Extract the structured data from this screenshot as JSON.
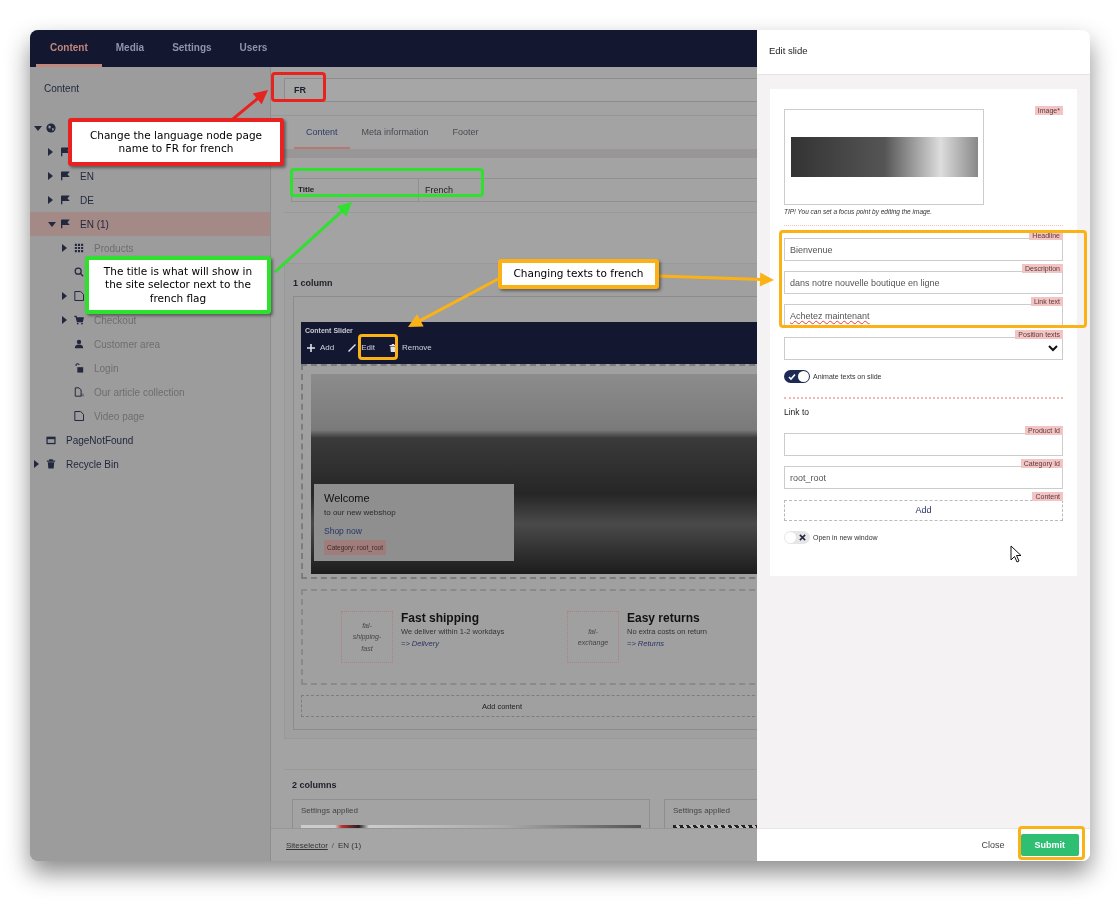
{
  "nav": {
    "tabs": [
      {
        "label": "Content",
        "selected": true
      },
      {
        "label": "Media",
        "selected": false
      },
      {
        "label": "Settings",
        "selected": false
      },
      {
        "label": "Users",
        "selected": false
      }
    ]
  },
  "sidebar": {
    "title": "Content",
    "tree": [
      {
        "kind": "site",
        "has_children": true,
        "expanded": true,
        "selected": false,
        "children": [
          {
            "kind": "language",
            "has_children": true,
            "expanded": false,
            "selected": false
          },
          {
            "kind": "language",
            "label": "EN",
            "has_children": true,
            "expanded": false,
            "selected": false
          },
          {
            "kind": "language",
            "label": "DE",
            "has_children": true,
            "expanded": false,
            "selected": false
          },
          {
            "kind": "language",
            "label": "EN (1)",
            "has_children": true,
            "expanded": true,
            "selected": true,
            "children": [
              {
                "kind": "catalog",
                "label": "Products",
                "has_children": true,
                "expanded": false,
                "selected": false
              },
              {
                "kind": "search",
                "has_children": false,
                "selected": false
              },
              {
                "kind": "page",
                "has_children": true,
                "expanded": false,
                "selected": false
              },
              {
                "kind": "cart",
                "label": "Checkout",
                "has_children": true,
                "expanded": false,
                "selected": false
              },
              {
                "kind": "account",
                "label": "Customer area",
                "has_children": false,
                "selected": false
              },
              {
                "kind": "login",
                "label": "Login",
                "has_children": false,
                "selected": false
              },
              {
                "kind": "collection",
                "label": "Our article collection",
                "has_children": false,
                "selected": false
              },
              {
                "kind": "page",
                "label": "Video page",
                "has_children": false,
                "selected": false
              }
            ]
          }
        ]
      },
      {
        "kind": "notfound",
        "label": "PageNotFound",
        "has_children": false,
        "selected": false
      },
      {
        "kind": "bin",
        "label": "Recycle Bin",
        "has_children": true,
        "expanded": false,
        "selected": false
      }
    ]
  },
  "editor": {
    "page_name": "FR",
    "tabs": [
      {
        "label": "Content",
        "selected": true
      },
      {
        "label": "Meta information",
        "selected": false
      },
      {
        "label": "Footer",
        "selected": false
      }
    ],
    "properties": [
      {
        "label": "Title",
        "value": "French"
      }
    ],
    "section_1": {
      "title": "1 column",
      "block_title": "Content Slider",
      "toolbar": [
        "Add",
        "Edit",
        "Remove"
      ],
      "slide": {
        "headline": "Welcome",
        "text": "to our new webshop",
        "link": "Shop now",
        "tag": "Category: root_root"
      },
      "usps": [
        {
          "icon_text": "fal-shipping-fast",
          "title": "Fast shipping",
          "text": "We deliver within 1-2 workdays",
          "link": "=> Delivery"
        },
        {
          "icon_text": "fal-exchange",
          "title": "Easy returns",
          "text": "No extra costs on return",
          "link": "=> Returns"
        }
      ],
      "add_content": "Add content"
    },
    "section_2": {
      "title": "2 columns",
      "columns": [
        {
          "label": "Settings applied"
        },
        {
          "label": "Settings applied"
        }
      ]
    },
    "breadcrumb": {
      "separator": "/",
      "items": [
        "Siteselector",
        "EN (1)"
      ]
    }
  },
  "panel": {
    "title": "Edit slide",
    "image_label": "Image*",
    "tip": "TIP! You can set a focus point by editing the image.",
    "fields": [
      {
        "kind": "text",
        "label": "Headline",
        "value": "Bienvenue"
      },
      {
        "kind": "text",
        "label": "Description",
        "value": "dans notre nouvelle boutique en ligne"
      },
      {
        "kind": "text",
        "label": "Link text",
        "value": "Achetez maintenant"
      },
      {
        "kind": "select",
        "label": "Position texts"
      }
    ],
    "animate": {
      "label": "Animate texts on slide",
      "on": true
    },
    "link_heading": "Link to",
    "link_fields": [
      {
        "kind": "text",
        "label": "Product Id"
      },
      {
        "kind": "text",
        "label": "Category Id",
        "value": "root_root"
      },
      {
        "kind": "button",
        "label": "Content",
        "value": "Add"
      }
    ],
    "new_window": {
      "label": "Open in new window",
      "on": false
    },
    "buttons": [
      "Close",
      "Submit"
    ]
  },
  "callouts": [
    {
      "text": "Change the language node page name to FR for french",
      "color": "#e8231f"
    },
    {
      "text": "The title is what will show in the site selector next to the french flag",
      "color": "#2fe02f"
    },
    {
      "text": "Changing texts to french",
      "color": "#fbb217"
    }
  ],
  "highlights": [
    {
      "color": "#e8231f"
    },
    {
      "color": "#2fe02f"
    },
    {
      "color": "#fbb217"
    },
    {
      "color": "#fbb217"
    },
    {
      "color": "#fbb217"
    }
  ],
  "arrows": [
    {
      "color": "#e8231f"
    },
    {
      "color": "#2fe02f"
    },
    {
      "color": "#fbb217"
    },
    {
      "color": "#fbb217"
    }
  ]
}
